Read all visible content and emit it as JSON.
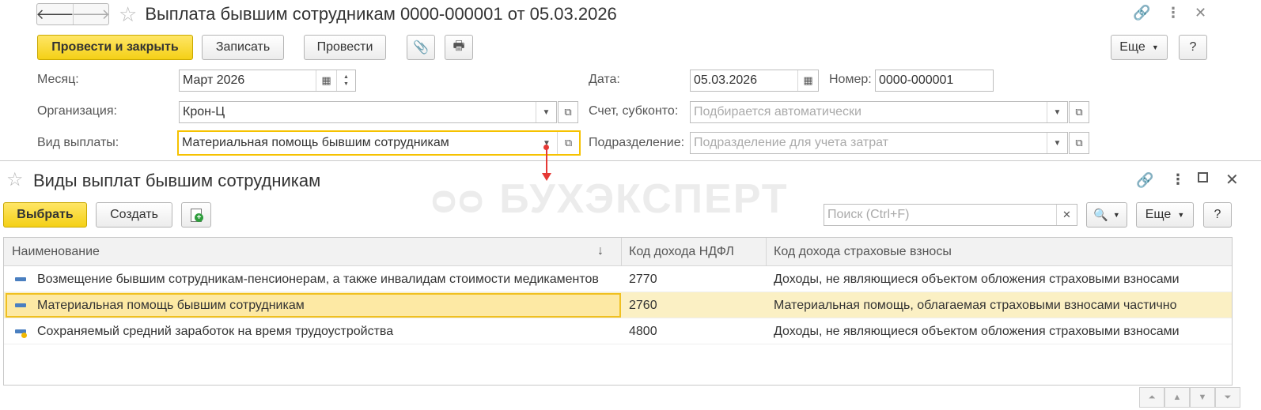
{
  "doc": {
    "title": "Выплата бывшим сотрудникам 0000-000001 от 05.03.2026",
    "nav_back": "🡐",
    "nav_forward": "🡒",
    "buttons": {
      "post_close": "Провести и закрыть",
      "save": "Записать",
      "post": "Провести",
      "more": "Еще",
      "help": "?"
    },
    "fields": {
      "month_label": "Месяц:",
      "month_value": "Март 2026",
      "date_label": "Дата:",
      "date_value": "05.03.2026",
      "number_label": "Номер:",
      "number_value": "0000-000001",
      "org_label": "Организация:",
      "org_value": "Крон-Ц",
      "account_label": "Счет, субконто:",
      "account_placeholder": "Подбирается автоматически",
      "pay_type_label": "Вид выплаты:",
      "pay_type_value": "Материальная помощь бывшим сотрудникам",
      "dept_label": "Подразделение:",
      "dept_placeholder": "Подразделение для учета затрат"
    }
  },
  "watermark": "БУХЭКСПЕРТ",
  "selector": {
    "title": "Виды выплат бывшим сотрудникам",
    "buttons": {
      "choose": "Выбрать",
      "create": "Создать",
      "more": "Еще",
      "help": "?"
    },
    "search_placeholder": "Поиск (Ctrl+F)",
    "columns": [
      "Наименование",
      "Код дохода НДФЛ",
      "Код дохода страховые взносы"
    ],
    "sort_indicator": "↓",
    "rows": [
      {
        "name": "Возмещение бывшим сотрудникам-пенсионерам, а также инвалидам стоимости медикаментов",
        "ndfl": "2770",
        "insurance": "Доходы, не являющиеся объектом обложения страховыми взносами"
      },
      {
        "name": "Материальная помощь бывшим сотрудникам",
        "ndfl": "2760",
        "insurance": "Материальная помощь, облагаемая страховыми взносами частично"
      },
      {
        "name": "Сохраняемый средний заработок на время трудоустройства",
        "ndfl": "4800",
        "insurance": "Доходы, не являющиеся объектом обложения страховыми взносами"
      }
    ],
    "selected_row": 1
  },
  "colors": {
    "primary_button": "#f4d016",
    "selected_row": "#fbf0c4",
    "arrow": "#e53935",
    "focus_border": "#f6c200"
  }
}
